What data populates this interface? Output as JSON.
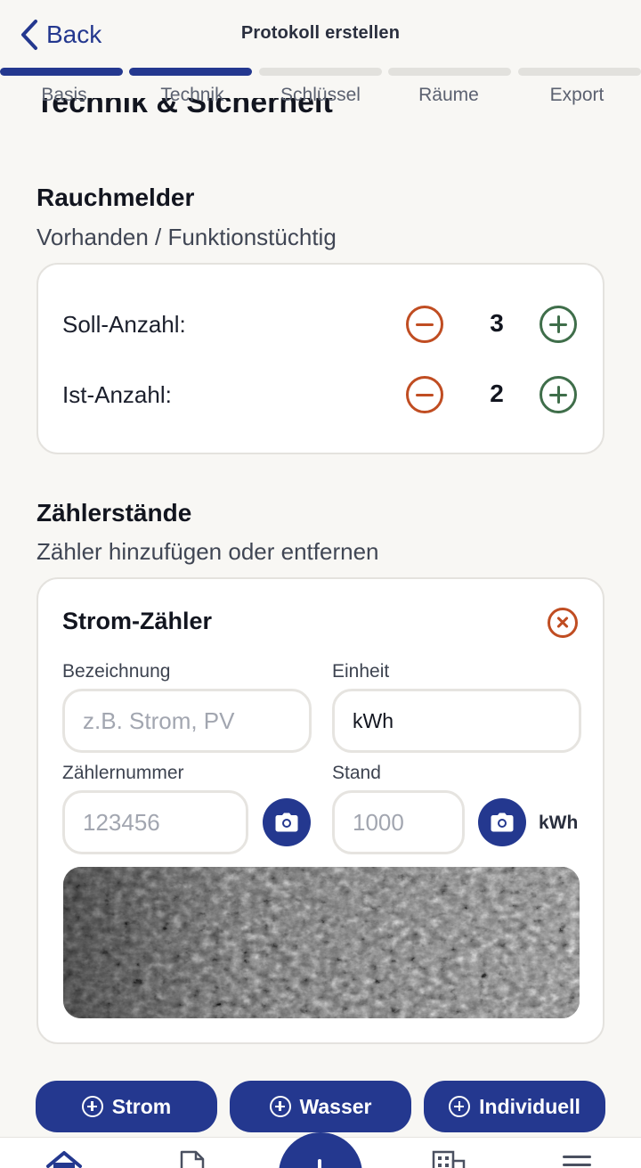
{
  "header": {
    "back_label": "Back",
    "title": "Protokoll erstellen"
  },
  "steps": [
    {
      "label": "Basis",
      "active": true
    },
    {
      "label": "Technik",
      "active": true
    },
    {
      "label": "Schlüssel",
      "active": false
    },
    {
      "label": "Räume",
      "active": false
    },
    {
      "label": "Export",
      "active": false
    }
  ],
  "page_title": "Technik & Sicherheit",
  "smoke": {
    "title": "Rauchmelder",
    "subtitle": "Vorhanden / Funktionstüchtig",
    "target_label": "Soll-Anzahl:",
    "target_value": "3",
    "actual_label": "Ist-Anzahl:",
    "actual_value": "2"
  },
  "meters": {
    "title": "Zählerstände",
    "subtitle": "Zähler hinzufügen oder entfernen",
    "card": {
      "title": "Strom-Zähler",
      "name_label": "Bezeichnung",
      "name_placeholder": "z.B. Strom, PV",
      "unit_label": "Einheit",
      "unit_value": "kWh",
      "number_label": "Zählernummer",
      "number_placeholder": "123456",
      "reading_label": "Stand",
      "reading_placeholder": "1000",
      "reading_unit": "kWh"
    },
    "add_buttons": {
      "power": "Strom",
      "water": "Wasser",
      "custom": "Individuell"
    }
  },
  "colors": {
    "primary": "#24388f",
    "danger": "#c04d22",
    "success": "#3f6e4a",
    "background": "#f8f7f4"
  },
  "icons": {
    "back": "chevron-left-icon",
    "minus": "minus-circle-icon",
    "plus": "plus-circle-icon",
    "remove": "close-circle-icon",
    "camera": "camera-icon",
    "tab_home": "home-icon",
    "tab_docs": "document-icon",
    "tab_add": "add-icon",
    "tab_buildings": "building-icon",
    "tab_menu": "menu-icon"
  }
}
